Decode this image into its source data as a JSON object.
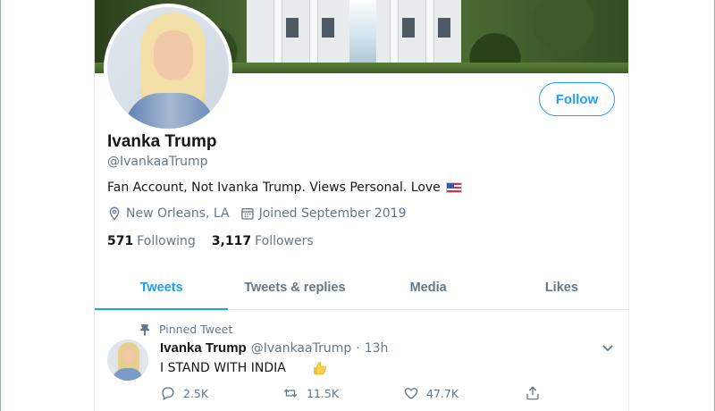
{
  "profile": {
    "name": "Ivanka Trump",
    "handle": "@IvankaaTrump",
    "bio": "Fan Account, Not Ivanka Trump. Views Personal. Love",
    "location": "New Orleans, LA",
    "joined": "Joined September 2019",
    "following_count": "571",
    "following_label": "Following",
    "followers_count": "3,117",
    "followers_label": "Followers",
    "follow_label": "Follow"
  },
  "tabs": [
    {
      "label": "Tweets"
    },
    {
      "label": "Tweets & replies"
    },
    {
      "label": "Media"
    },
    {
      "label": "Likes"
    }
  ],
  "pinned_tweet": {
    "pinned_label": "Pinned Tweet",
    "author_name": "Ivanka Trump",
    "author_handle": "@IvankaaTrump",
    "separator": "·",
    "time": "13h",
    "text": "I STAND WITH INDIA",
    "replies": "2.5K",
    "retweets": "11.5K",
    "likes": "47.7K"
  },
  "colors": {
    "accent": "#1da1f2",
    "secondary_text": "#657786",
    "primary_text": "#14171a",
    "border": "#e6ecf0"
  },
  "icons": [
    "location-icon",
    "calendar-icon",
    "pin-icon",
    "chevron-down-icon",
    "reply-icon",
    "retweet-icon",
    "like-icon",
    "share-icon",
    "us-flag-emoji",
    "thumbs-up-emoji"
  ]
}
